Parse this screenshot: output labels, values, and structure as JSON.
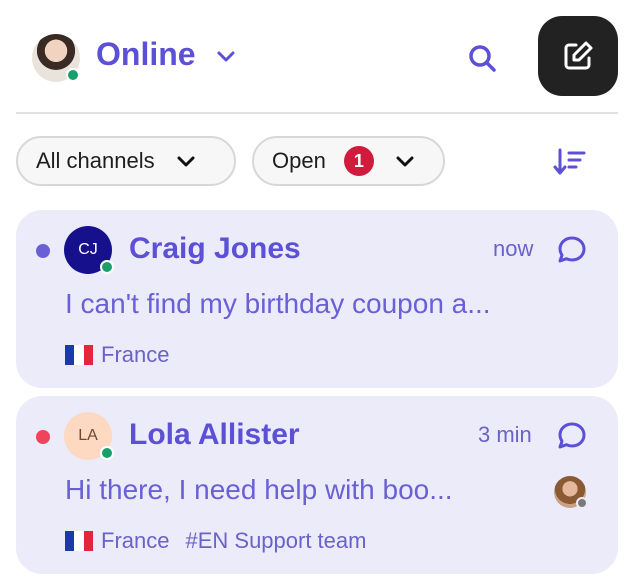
{
  "header": {
    "status_label": "Online",
    "icons": [
      "user-avatar",
      "chevron-down-icon",
      "search-icon",
      "compose-icon"
    ]
  },
  "filters": {
    "channels_label": "All channels",
    "status_label": "Open",
    "status_count": "1",
    "sort_icon": "sort-icon"
  },
  "conversations": [
    {
      "initials": "CJ",
      "name": "Craig Jones",
      "time": "now",
      "preview": "I can't find my birthday coupon a...",
      "country": "France",
      "team": ""
    },
    {
      "initials": "LA",
      "name": "Lola Allister",
      "time": "3 min",
      "preview": "Hi there, I need help with boo...",
      "country": "France",
      "team": "#EN Support team"
    }
  ],
  "colors": {
    "accent": "#5b50d6",
    "card_bg": "#ecebfa",
    "online": "#17a06a",
    "badge": "#d01b3d",
    "unread_blue": "#6a60d6",
    "unread_red": "#f0445a",
    "cj_avatar": "#17108c",
    "la_avatar": "#fcd9c0"
  }
}
